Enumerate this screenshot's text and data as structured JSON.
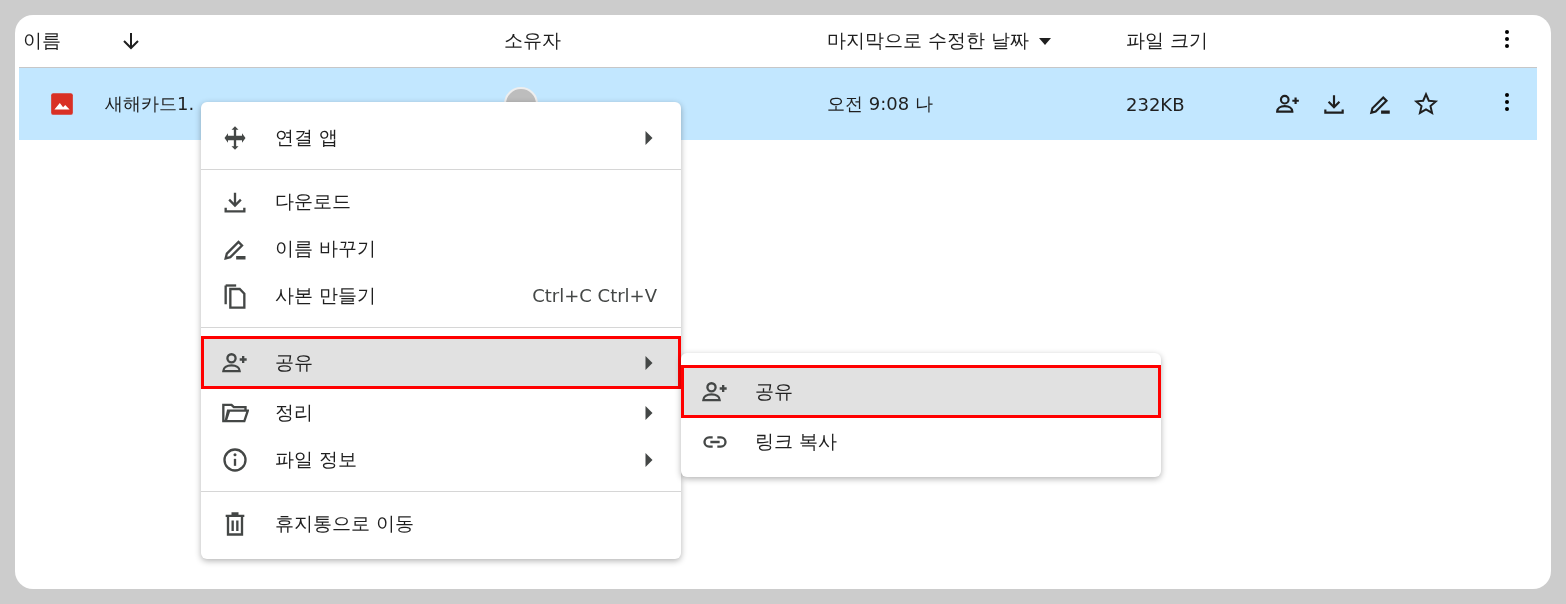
{
  "file_list": {
    "columns": [
      {
        "label": "이름",
        "kind": "sort-arrow"
      },
      {
        "label": "소유자",
        "kind": "plain"
      },
      {
        "label": "마지막으로 수정한 날짜",
        "kind": "dropdown"
      },
      {
        "label": "파일 크기",
        "kind": "plain"
      }
    ],
    "rows": [
      {
        "name": "새해카드1.",
        "modified": "오전 9:08 나",
        "size": "232KB",
        "selected": true
      }
    ]
  },
  "context_menu": {
    "items": [
      {
        "kind": "item",
        "label": "연결 앱",
        "submenu": true,
        "selected": false
      },
      {
        "kind": "divider"
      },
      {
        "kind": "item",
        "label": "다운로드",
        "submenu": false,
        "selected": false
      },
      {
        "kind": "item",
        "label": "이름 바꾸기",
        "submenu": false,
        "selected": false
      },
      {
        "kind": "item",
        "label": "사본 만들기",
        "shortcut": "Ctrl+C Ctrl+V",
        "submenu": false,
        "selected": false
      },
      {
        "kind": "divider"
      },
      {
        "kind": "item",
        "label": "공유",
        "submenu": true,
        "selected": true
      },
      {
        "kind": "item",
        "label": "정리",
        "submenu": true,
        "selected": false
      },
      {
        "kind": "item",
        "label": "파일 정보",
        "submenu": true,
        "selected": false
      },
      {
        "kind": "divider"
      },
      {
        "kind": "item",
        "label": "휴지통으로 이동",
        "submenu": false,
        "selected": false
      }
    ]
  },
  "share_submenu": {
    "items": [
      {
        "kind": "item",
        "label": "공유",
        "selected": true
      },
      {
        "kind": "item",
        "label": "링크 복사",
        "selected": false
      }
    ]
  }
}
